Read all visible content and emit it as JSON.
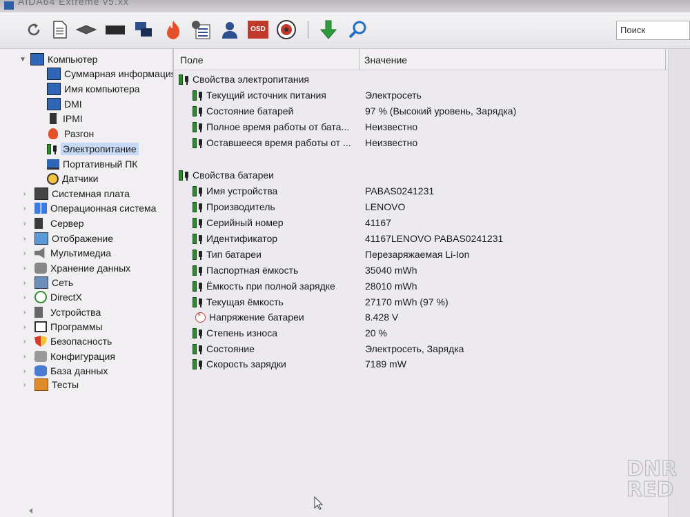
{
  "window": {
    "title": "AIDA64 Extreme v5.xx"
  },
  "toolbar": {
    "buttons": [
      "refresh-icon",
      "report-icon",
      "motherboard-icon",
      "memory-icon",
      "network-icon",
      "overclock-icon",
      "tools-icon",
      "user-icon",
      "osd-icon",
      "sensor-icon",
      "download-icon",
      "search-icon"
    ],
    "osd_label": "OSD",
    "search_placeholder": "Поиск"
  },
  "tree": {
    "root": {
      "label": "Компьютер"
    },
    "children": [
      {
        "label": "Суммарная информация"
      },
      {
        "label": "Имя компьютера"
      },
      {
        "label": "DMI"
      },
      {
        "label": "IPMI"
      },
      {
        "label": "Разгон"
      },
      {
        "label": "Электропитание"
      },
      {
        "label": "Портативный ПК"
      },
      {
        "label": "Датчики"
      }
    ],
    "groups": [
      {
        "label": "Системная плата"
      },
      {
        "label": "Операционная система"
      },
      {
        "label": "Сервер"
      },
      {
        "label": "Отображение"
      },
      {
        "label": "Мультимедиа"
      },
      {
        "label": "Хранение данных"
      },
      {
        "label": "Сеть"
      },
      {
        "label": "DirectX"
      },
      {
        "label": "Устройства"
      },
      {
        "label": "Программы"
      },
      {
        "label": "Безопасность"
      },
      {
        "label": "Конфигурация"
      },
      {
        "label": "База данных"
      },
      {
        "label": "Тесты"
      }
    ]
  },
  "table": {
    "col_field": "Поле",
    "col_value": "Значение",
    "section1": {
      "title": "Свойства электропитания",
      "rows": [
        {
          "field": "Текущий источник питания",
          "value": "Электросеть"
        },
        {
          "field": "Состояние батарей",
          "value": "97 % (Высокий уровень, Зарядка)"
        },
        {
          "field": "Полное время работы от бата...",
          "value": "Неизвестно"
        },
        {
          "field": "Оставшееся время работы от ...",
          "value": "Неизвестно"
        }
      ]
    },
    "section2": {
      "title": "Свойства батареи",
      "rows": [
        {
          "field": "Имя устройства",
          "value": "PABAS0241231"
        },
        {
          "field": "Производитель",
          "value": "LENOVO"
        },
        {
          "field": "Серийный номер",
          "value": "41167"
        },
        {
          "field": "Идентификатор",
          "value": "41167LENOVO PABAS0241231"
        },
        {
          "field": "Тип батареи",
          "value": "Перезаряжаемая Li-Ion"
        },
        {
          "field": "Паспортная ёмкость",
          "value": "35040 mWh"
        },
        {
          "field": "Ёмкость при полной зарядке",
          "value": "28010 mWh"
        },
        {
          "field": "Текущая ёмкость",
          "value": "27170 mWh  (97 %)"
        },
        {
          "field": "Напряжение батареи",
          "value": "8.428 V"
        },
        {
          "field": "Степень износа",
          "value": "20 %"
        },
        {
          "field": "Состояние",
          "value": "Электросеть, Зарядка"
        },
        {
          "field": "Скорость зарядки",
          "value": "7189 mW"
        }
      ]
    }
  },
  "watermark": "DNR RED"
}
